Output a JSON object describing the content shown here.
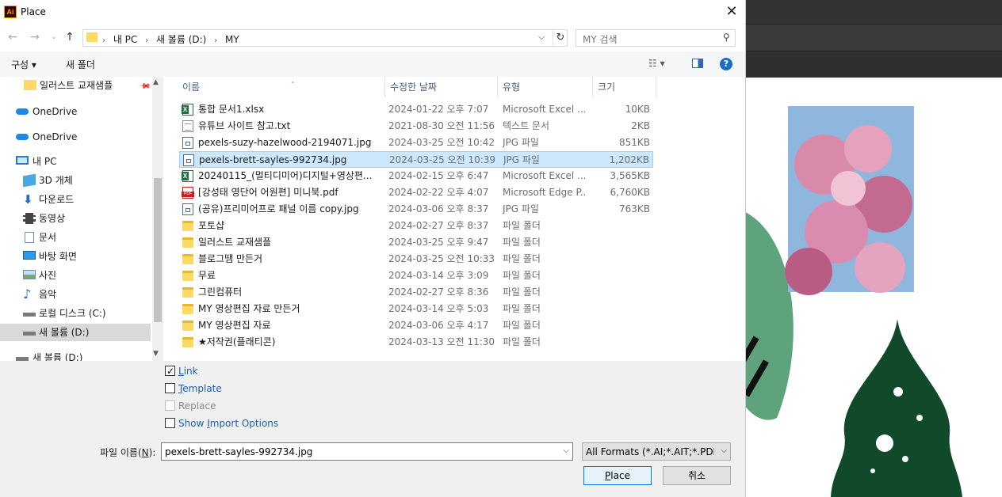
{
  "dialog": {
    "title": "Place",
    "app_icon_text": "Ai",
    "close_label": "✕"
  },
  "address": {
    "crumbs": [
      "내 PC",
      "새 볼륨 (D:)",
      "MY"
    ]
  },
  "search": {
    "placeholder": "MY 검색"
  },
  "toolbar": {
    "organize_label": "구성 ▾",
    "new_folder_label": "새 폴더",
    "view_label": "☷ ▾",
    "help_label": "?"
  },
  "navpane": {
    "items": [
      {
        "label": "일러스트 교재샘플",
        "icon": "folder-icon"
      },
      {
        "label": "OneDrive",
        "icon": "cloud-icon"
      },
      {
        "label": "OneDrive",
        "icon": "cloud-icon"
      },
      {
        "label": "내 PC",
        "icon": "computer-icon"
      },
      {
        "label": "3D 개체",
        "icon": "cube-icon"
      },
      {
        "label": "다운로드",
        "icon": "download-icon"
      },
      {
        "label": "동영상",
        "icon": "video-icon"
      },
      {
        "label": "문서",
        "icon": "document-icon"
      },
      {
        "label": "바탕 화면",
        "icon": "desktop-icon"
      },
      {
        "label": "사진",
        "icon": "pictures-icon"
      },
      {
        "label": "음악",
        "icon": "music-icon"
      },
      {
        "label": "로컬 디스크 (C:)",
        "icon": "drive-icon"
      },
      {
        "label": "새 볼륨 (D:)",
        "icon": "drive-icon"
      },
      {
        "label": "새 볼륨 (D:)",
        "icon": "drive-icon"
      }
    ]
  },
  "columns": {
    "name": "이름",
    "date": "수정한 날짜",
    "type": "유형",
    "size": "크기"
  },
  "files": [
    {
      "name": "통합 문서1.xlsx",
      "date": "2024-01-22 오후 7:07",
      "type": "Microsoft Excel ...",
      "size": "10KB",
      "icon": "xlsx"
    },
    {
      "name": "유튜브 사이트 참고.txt",
      "date": "2021-08-30 오전 11:56",
      "type": "텍스트 문서",
      "size": "2KB",
      "icon": "txt"
    },
    {
      "name": "pexels-suzy-hazelwood-2194071.jpg",
      "date": "2024-03-25 오전 10:42",
      "type": "JPG 파일",
      "size": "851KB",
      "icon": "jpg"
    },
    {
      "name": "pexels-brett-sayles-992734.jpg",
      "date": "2024-03-25 오전 10:39",
      "type": "JPG 파일",
      "size": "1,202KB",
      "icon": "jpg"
    },
    {
      "name": "20240115_(멀티디미어)디지털+영상편...",
      "date": "2024-02-15 오후 6:47",
      "type": "Microsoft Excel ...",
      "size": "3,565KB",
      "icon": "xlsx"
    },
    {
      "name": "[강성태 영단어 어원편] 미니북.pdf",
      "date": "2024-02-22 오후 4:07",
      "type": "Microsoft Edge P...",
      "size": "6,760KB",
      "icon": "pdf"
    },
    {
      "name": "(공유)프리미어프로 패널 이름 copy.jpg",
      "date": "2024-03-06 오후 8:37",
      "type": "JPG 파일",
      "size": "763KB",
      "icon": "jpg"
    },
    {
      "name": "포토샵",
      "date": "2024-02-27 오후 8:37",
      "type": "파일 폴더",
      "size": "",
      "icon": "folder"
    },
    {
      "name": "일러스트 교재샘플",
      "date": "2024-03-25 오후 9:47",
      "type": "파일 폴더",
      "size": "",
      "icon": "folder"
    },
    {
      "name": "블로그땜 만든거",
      "date": "2024-03-25 오전 10:33",
      "type": "파일 폴더",
      "size": "",
      "icon": "folder"
    },
    {
      "name": "무료",
      "date": "2024-03-14 오후 3:09",
      "type": "파일 폴더",
      "size": "",
      "icon": "folder"
    },
    {
      "name": "그린컴퓨터",
      "date": "2024-02-27 오후 8:36",
      "type": "파일 폴더",
      "size": "",
      "icon": "folder"
    },
    {
      "name": "MY 영상편집 자료 만든거",
      "date": "2024-03-14 오후 5:03",
      "type": "파일 폴더",
      "size": "",
      "icon": "folder"
    },
    {
      "name": "MY 영상편집 자료",
      "date": "2024-03-06 오후 4:17",
      "type": "파일 폴더",
      "size": "",
      "icon": "folder"
    },
    {
      "name": "★저작권(플래티콘)",
      "date": "2024-03-13 오전 11:30",
      "type": "파일 폴더",
      "size": "",
      "icon": "folder"
    }
  ],
  "selected_index": 3,
  "options": {
    "link": {
      "pre": "",
      "key": "L",
      "post": "ink",
      "checked": true,
      "disabled": false
    },
    "template": {
      "pre": "",
      "key": "T",
      "post": "emplate",
      "checked": false,
      "disabled": false
    },
    "replace": {
      "pre": "Replace",
      "key": "",
      "post": "",
      "checked": false,
      "disabled": true
    },
    "show_import": {
      "pre": "Show ",
      "key": "I",
      "post": "mport Options",
      "checked": false,
      "disabled": false
    }
  },
  "filename": {
    "label_pre": "파일 이름(",
    "label_key": "N",
    "label_post": "):",
    "value": "pexels-brett-sayles-992734.jpg"
  },
  "format": {
    "value": "All Formats (*.AI;*.AIT;*.PDF;*.D"
  },
  "buttons": {
    "place": {
      "key": "P",
      "rest": "lace"
    },
    "cancel_label": "취소"
  },
  "colors": {
    "selection_bg": "#cce8ff",
    "selection_border": "#99d1ff",
    "accent_blue": "#0078d7",
    "leaf_green": "#5ea37c",
    "tree_green": "#114a2a"
  }
}
